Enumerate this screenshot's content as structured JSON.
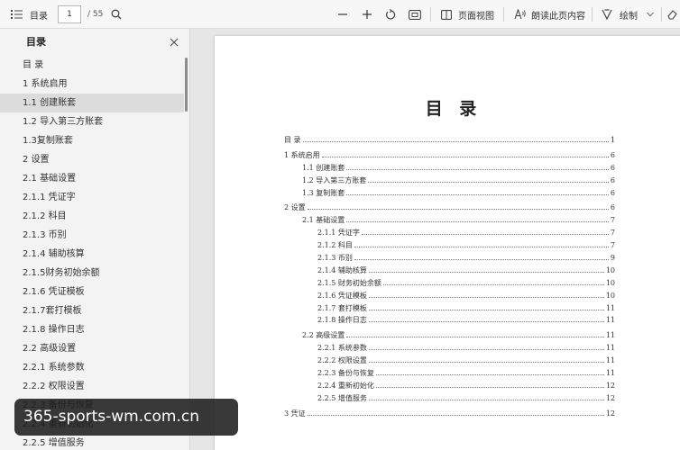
{
  "toolbar": {
    "toc_label": "目录",
    "page_current": "1",
    "page_total": "/ 55",
    "page_view_label": "页面视图",
    "read_aloud_label": "朗读此页内容",
    "draw_label": "绘制"
  },
  "sidebar": {
    "title": "目录",
    "items": [
      {
        "label": "目 录"
      },
      {
        "label": "1 系统启用"
      },
      {
        "label": "1.1 创建账套"
      },
      {
        "label": "1.2 导入第三方账套"
      },
      {
        "label": "1.3复制账套"
      },
      {
        "label": "2 设置"
      },
      {
        "label": "2.1 基础设置"
      },
      {
        "label": "2.1.1 凭证字"
      },
      {
        "label": "2.1.2 科目"
      },
      {
        "label": "2.1.3 币别"
      },
      {
        "label": "2.1.4 辅助核算"
      },
      {
        "label": "2.1.5财务初始余额"
      },
      {
        "label": "2.1.6 凭证模板"
      },
      {
        "label": "2.1.7套打模板"
      },
      {
        "label": "2.1.8 操作日志"
      },
      {
        "label": "2.2 高级设置"
      },
      {
        "label": "2.2.1 系统参数"
      },
      {
        "label": "2.2.2 权限设置"
      },
      {
        "label": "2.2.3 备份与恢复"
      },
      {
        "label": "2.2.4 重新初始化"
      },
      {
        "label": "2.2.5 增值服务"
      }
    ]
  },
  "document": {
    "title": "目 录",
    "toc": [
      {
        "label": "目  录",
        "page": "1"
      },
      {
        "label": "1  系统启用",
        "page": "6"
      },
      {
        "label": "1.1  创建账套",
        "page": "6"
      },
      {
        "label": "1.2  导入第三方账套",
        "page": "6"
      },
      {
        "label": "1.3 复制账套",
        "page": "6"
      },
      {
        "label": "2  设置",
        "page": "6"
      },
      {
        "label": "2.1  基础设置",
        "page": "7"
      },
      {
        "label": "2.1.1  凭证字",
        "page": "7"
      },
      {
        "label": "2.1.2  科目",
        "page": "7"
      },
      {
        "label": "2.1.3  币别",
        "page": "9"
      },
      {
        "label": "2.1.4  辅助核算",
        "page": "10"
      },
      {
        "label": "2.1.5 财务初始余额",
        "page": "10"
      },
      {
        "label": "2.1.6  凭证模板",
        "page": "10"
      },
      {
        "label": "2.1.7  套打模板",
        "page": "11"
      },
      {
        "label": "2.1.8  操作日志",
        "page": "11"
      },
      {
        "label": "2.2  高级设置",
        "page": "11"
      },
      {
        "label": "2.2.1  系统参数",
        "page": "11"
      },
      {
        "label": "2.2.2  权限设置",
        "page": "11"
      },
      {
        "label": "2.2.3  备份与恢复",
        "page": "11"
      },
      {
        "label": "2.2.4  重新初始化",
        "page": "12"
      },
      {
        "label": "2.2.5  增值服务",
        "page": "12"
      },
      {
        "label": "3  凭证",
        "page": "12"
      }
    ]
  },
  "watermark": {
    "text": "365-sports-wm.com.cn"
  }
}
